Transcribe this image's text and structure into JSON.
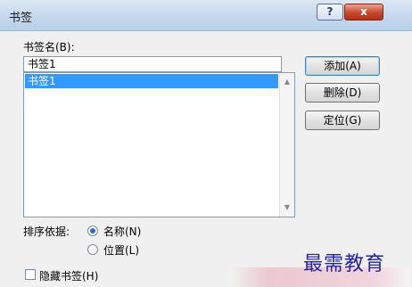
{
  "window": {
    "title": "书签",
    "help_label": "?",
    "close_label": "x"
  },
  "bookmark_name": {
    "label": "书签名(B):",
    "value": "书签1"
  },
  "bookmark_list": {
    "items": [
      "书签1"
    ],
    "selected_index": 0
  },
  "buttons": {
    "add": "添加(A)",
    "delete": "删除(D)",
    "goto": "定位(G)"
  },
  "sort": {
    "label": "排序依据:",
    "options": [
      "名称(N)",
      "位置(L)"
    ],
    "selected": "名称(N)"
  },
  "hidden_bookmarks": {
    "label": "隐藏书签(H)",
    "checked": false
  },
  "watermark": "最需教育"
}
